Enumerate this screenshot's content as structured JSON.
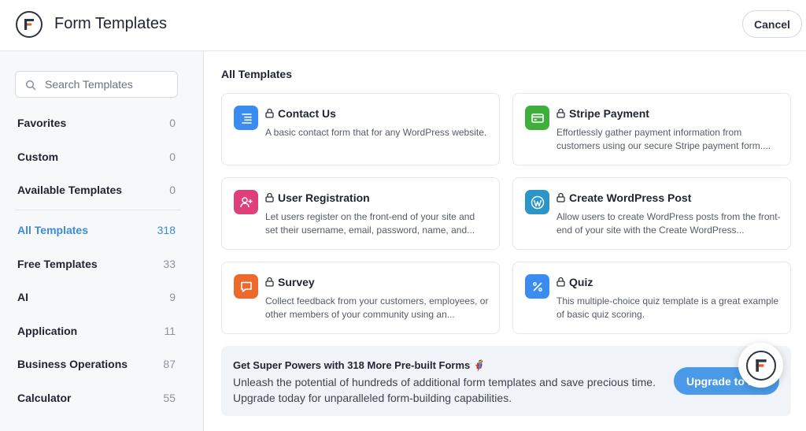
{
  "header": {
    "title": "Form Templates",
    "cancel_label": "Cancel"
  },
  "sidebar": {
    "search_placeholder": "Search Templates",
    "items": [
      {
        "label": "Favorites",
        "count": "0"
      },
      {
        "label": "Custom",
        "count": "0"
      },
      {
        "label": "Available Templates",
        "count": "0"
      },
      {
        "label": "All Templates",
        "count": "318",
        "active": true
      },
      {
        "label": "Free Templates",
        "count": "33"
      },
      {
        "label": "AI",
        "count": "9"
      },
      {
        "label": "Application",
        "count": "11"
      },
      {
        "label": "Business Operations",
        "count": "87"
      },
      {
        "label": "Calculator",
        "count": "55"
      }
    ]
  },
  "main": {
    "section_title": "All Templates",
    "cards": [
      {
        "title": "Contact Us",
        "description": "A basic contact form that for any WordPress website.",
        "icon": "list-icon",
        "icon_color": "#3b8cf0"
      },
      {
        "title": "Stripe Payment",
        "description": "Effortlessly gather payment information from customers using our secure Stripe payment form....",
        "icon": "credit-card-icon",
        "icon_color": "#3fae3a"
      },
      {
        "title": "User Registration",
        "description": "Let users register on the front-end of your site and set their username, email, password, name, and...",
        "icon": "user-plus-icon",
        "icon_color": "#e0407a"
      },
      {
        "title": "Create WordPress Post",
        "description": "Allow users to create WordPress posts from the front-end of your site with the Create WordPress...",
        "icon": "wordpress-icon",
        "icon_color": "#2a95c9"
      },
      {
        "title": "Survey",
        "description": "Collect feedback from your customers, employees, or other members of your community using an...",
        "icon": "chat-bubble-icon",
        "icon_color": "#ee6a2c"
      },
      {
        "title": "Quiz",
        "description": "This multiple-choice quiz template is a great example of basic quiz scoring.",
        "icon": "percent-icon",
        "icon_color": "#3b8cf0"
      }
    ]
  },
  "banner": {
    "title": "Get Super Powers with 318 More Pre-built Forms 🦸",
    "text": "Unleash the potential of hundreds of additional form templates and save precious time. Upgrade today for unparalleled form-building capabilities.",
    "upgrade_label": "Upgrade to Pro"
  },
  "colors": {
    "accent": "#3b8bd9",
    "button": "#4a9ae8"
  }
}
